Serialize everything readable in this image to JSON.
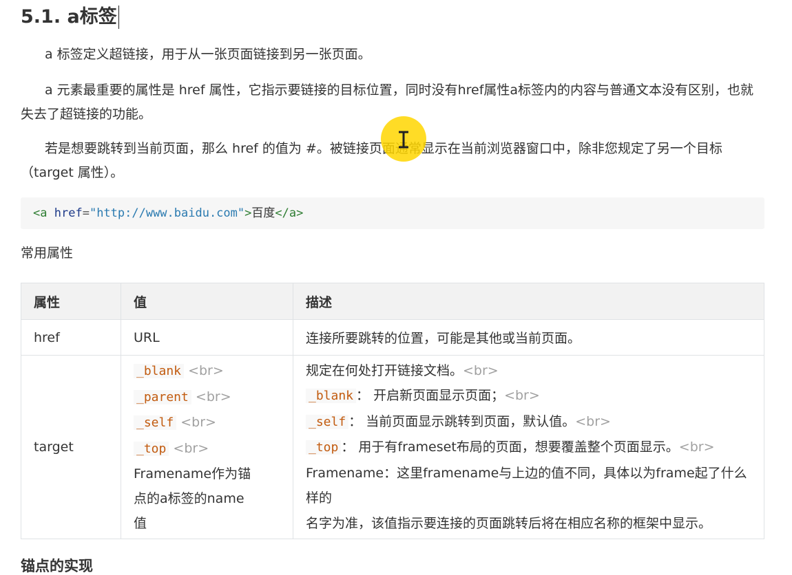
{
  "heading": "5.1. a标签",
  "paragraphs": [
    "a 标签定义超链接，用于从一张页面链接到另一张页面。",
    "a 元素最重要的属性是 href 属性，它指示要链接的目标位置，同时没有href属性a标签内的内容与普通文本没有区别，也就失去了超链接的功能。",
    "若是想要跳转到当前页面，那么 href 的值为 #。被链接页面通常显示在当前浏览器窗口中，除非您规定了另一个目标（target 属性）。"
  ],
  "code": {
    "lt": "<",
    "tag": "a",
    "attr": "href",
    "eq": "=",
    "value": "\"http://www.baidu.com\"",
    "gt": ">",
    "text": "百度",
    "close_lt": "</",
    "close_tag": "a",
    "close_gt": ">"
  },
  "subtitle": "常用属性",
  "table": {
    "headers": [
      "属性",
      "值",
      "描述"
    ],
    "row1": {
      "attr": "href",
      "value": "URL",
      "desc": "连接所要跳转的位置，可能是其他或当前页面。"
    },
    "row2": {
      "attr": "target",
      "values": [
        "_blank",
        "_parent",
        "_self",
        "_top"
      ],
      "br": "<br>",
      "value_text": [
        "Framename作为锚",
        "点的a标签的name",
        "值"
      ],
      "desc_intro": "规定在何处打开链接文档。",
      "desc_items": [
        {
          "code": "_blank",
          "text": "： 开启新页面显示页面；"
        },
        {
          "code": "_self",
          "text": "： 当前页面显示跳转到页面，默认值。"
        },
        {
          "code": "_top",
          "text": "： 用于有frameset布局的页面，想要覆盖整个页面显示。"
        }
      ],
      "desc_tail": [
        "Framename：这里framename与上边的值不同，具体以为frame起了什么样的",
        "名字为准，该值指示要连接的页面跳转后将在相应名称的框架中显示。"
      ]
    }
  },
  "next_heading": "锚点的实现"
}
